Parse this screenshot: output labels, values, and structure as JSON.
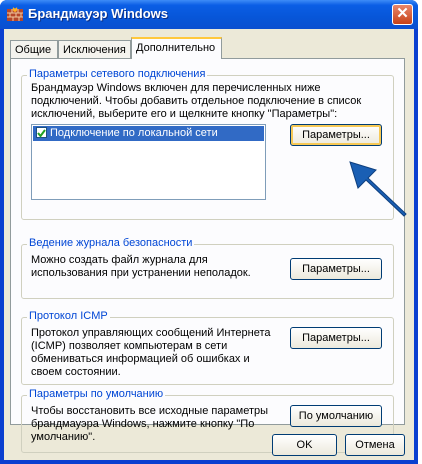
{
  "window": {
    "title": "Брандмауэр Windows",
    "close_symbol": "✕"
  },
  "tabs": [
    {
      "label": "Общие"
    },
    {
      "label": "Исключения"
    },
    {
      "label": "Дополнительно",
      "active": true
    }
  ],
  "network_group": {
    "title": "Параметры сетевого подключения",
    "description": "Брандмауэр Windows включен для перечисленных ниже подключений. Чтобы добавить отдельное подключение в список исключений, выберите его и щелкните кнопку \"Параметры\":",
    "connections": [
      {
        "label": "Подключение по локальной сети",
        "checked": true,
        "selected": true
      }
    ],
    "settings_button": "Параметры..."
  },
  "log_group": {
    "title": "Ведение журнала безопасности",
    "description": "Можно создать файл журнала для использования при устранении неполадок.",
    "settings_button": "Параметры..."
  },
  "icmp_group": {
    "title": "Протокол ICMP",
    "description": "Протокол управляющих сообщений Интернета (ICMP) позволяет компьютерам в сети обмениваться информацией об ошибках и своем состоянии.",
    "settings_button": "Параметры..."
  },
  "defaults_group": {
    "title": "Параметры по умолчанию",
    "description": "Чтобы восстановить все исходные параметры брандмауэра Windows, нажмите кнопку \"По умолчанию\".",
    "default_button": "По умолчанию"
  },
  "footer": {
    "ok_button": "OK",
    "cancel_button": "Отмена"
  },
  "colors": {
    "titlebar": "#0756d8",
    "group_title": "#0046d5",
    "selection": "#316ac5",
    "arrow": "#1a5fb4"
  },
  "annotations": {
    "arrow_icon": "pointer-arrow-icon"
  }
}
